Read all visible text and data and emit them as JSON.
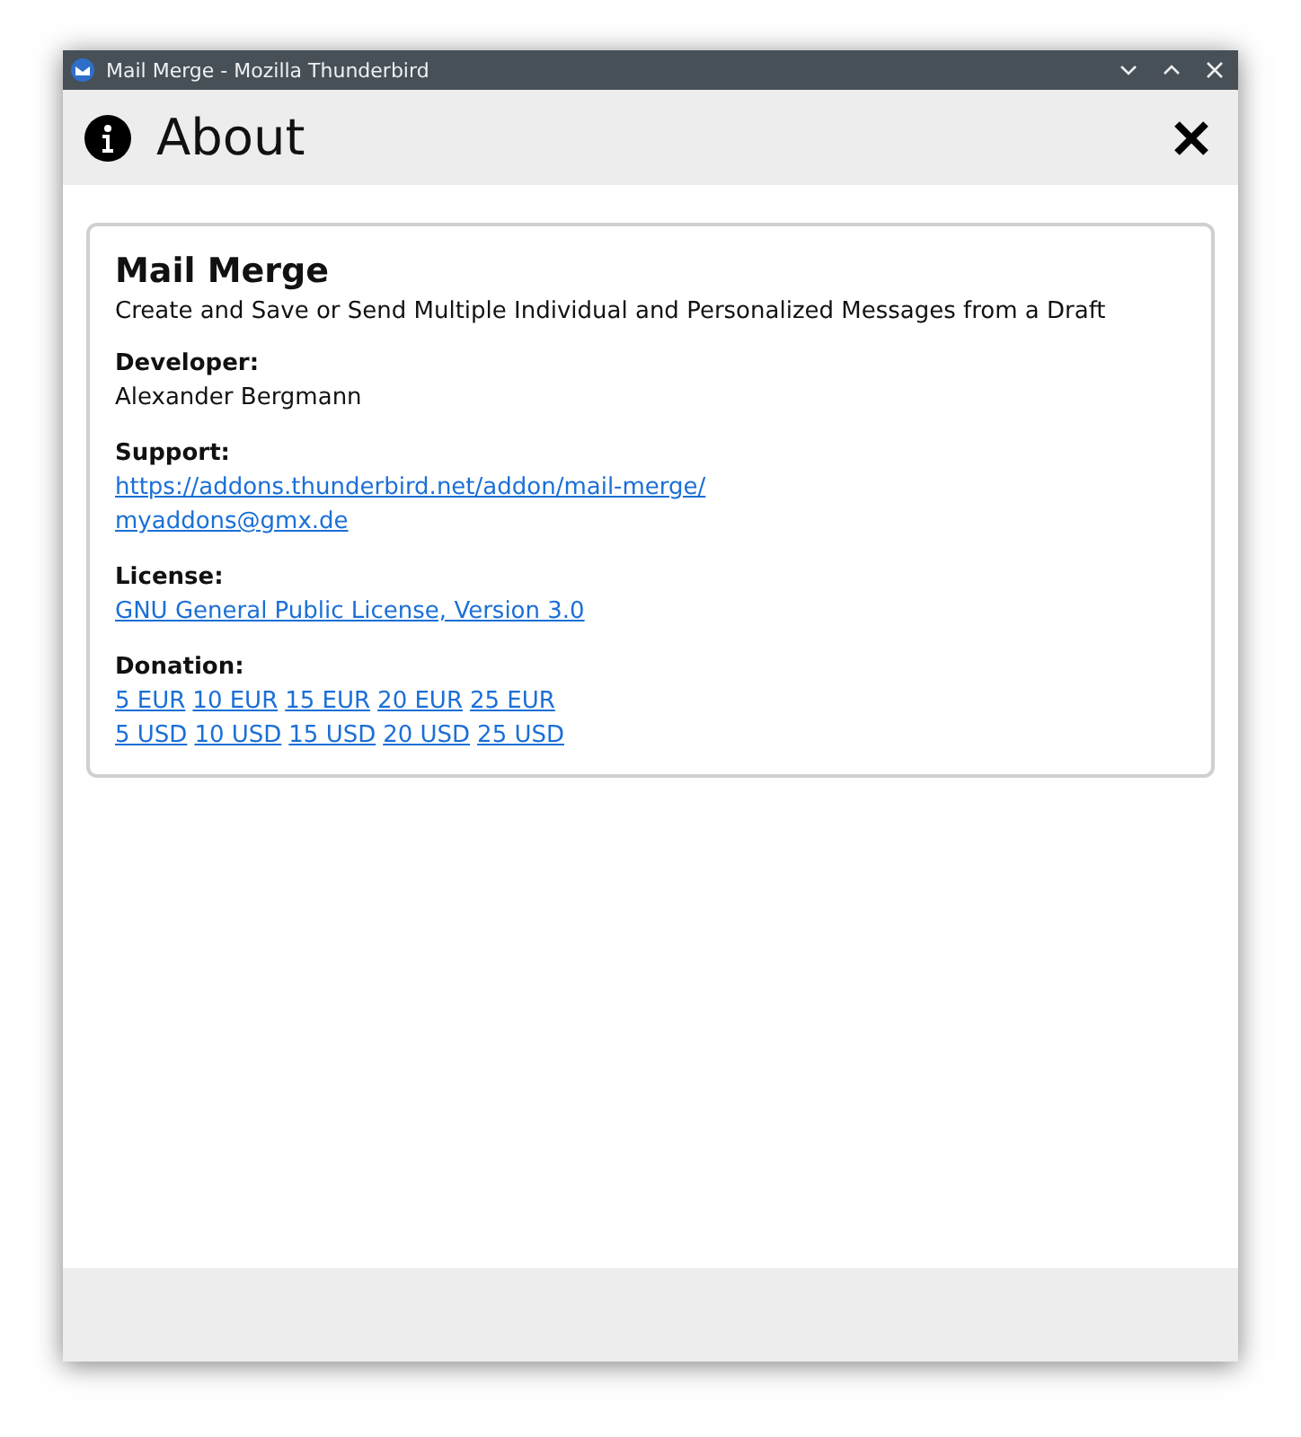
{
  "window": {
    "title": "Mail Merge - Mozilla Thunderbird"
  },
  "header": {
    "title": "About"
  },
  "card": {
    "title": "Mail Merge",
    "description": "Create and Save or Send Multiple Individual and Personalized Messages from a Draft",
    "sections": [
      {
        "label": "Developer:",
        "kind": "text",
        "lines": [
          [
            "Alexander Bergmann"
          ]
        ]
      },
      {
        "label": "Support:",
        "kind": "links",
        "lines": [
          [
            "https://addons.thunderbird.net/addon/mail-merge/"
          ],
          [
            "myaddons@gmx.de"
          ]
        ]
      },
      {
        "label": "License:",
        "kind": "links",
        "lines": [
          [
            "GNU General Public License, Version 3.0"
          ]
        ]
      },
      {
        "label": "Donation:",
        "kind": "links",
        "lines": [
          [
            "5 EUR",
            "10 EUR",
            "15 EUR",
            "20 EUR",
            "25 EUR"
          ],
          [
            "5 USD",
            "10 USD",
            "15 USD",
            "20 USD",
            "25 USD"
          ]
        ]
      }
    ]
  }
}
